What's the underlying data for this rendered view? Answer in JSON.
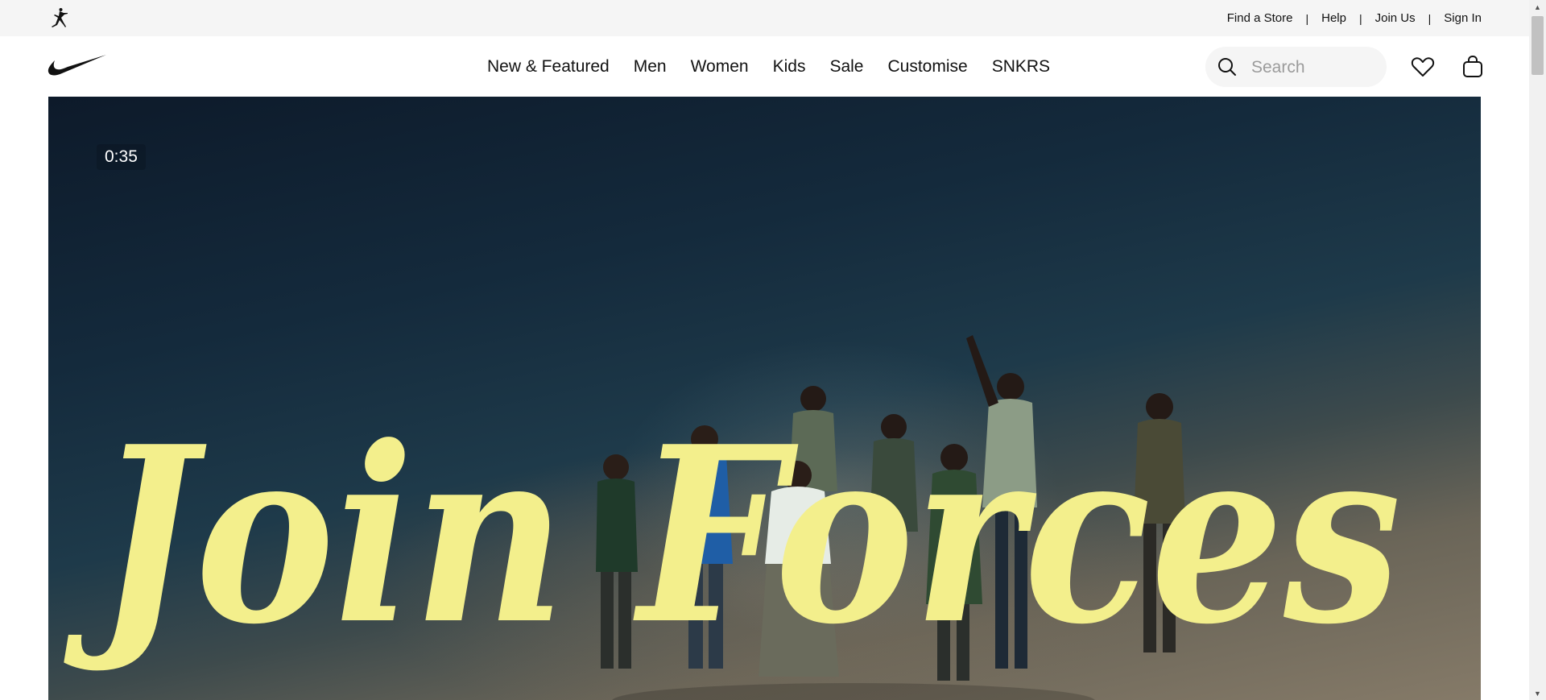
{
  "utility_nav": {
    "links": [
      "Find a Store",
      "Help",
      "Join Us",
      "Sign In"
    ],
    "separator": "|"
  },
  "header": {
    "logo_icon": "nike-swoosh-icon",
    "nav": [
      "New & Featured",
      "Men",
      "Women",
      "Kids",
      "Sale",
      "Customise",
      "SNKRS"
    ],
    "search_placeholder": "Search"
  },
  "hero": {
    "video_timer": "0:35",
    "headline": "Join Forces"
  },
  "colors": {
    "utility_bg": "#f5f5f5",
    "text": "#111111",
    "headline": "#f3ef8c"
  }
}
